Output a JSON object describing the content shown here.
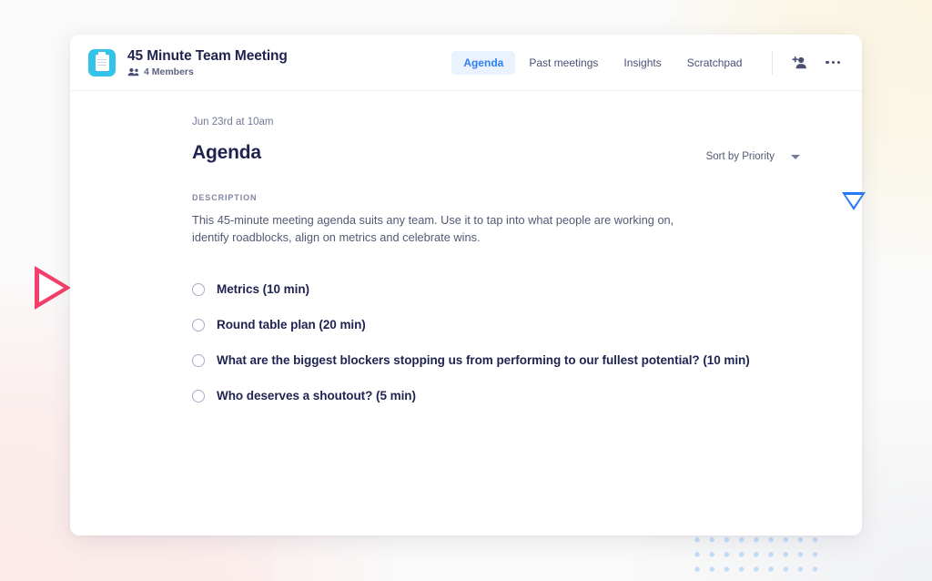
{
  "header": {
    "app_icon": "clipboard-icon",
    "meeting_title": "45 Minute Team Meeting",
    "members_icon": "people-icon",
    "members_text": "4 Members",
    "tabs": [
      {
        "label": "Agenda",
        "active": true
      },
      {
        "label": "Past meetings",
        "active": false
      },
      {
        "label": "Insights",
        "active": false
      },
      {
        "label": "Scratchpad",
        "active": false
      }
    ],
    "add_person_icon": "add-person-icon",
    "more_icon": "more-options-icon"
  },
  "main": {
    "date": "Jun 23rd at 10am",
    "page_title": "Agenda",
    "sort": {
      "label": "Sort by Priority",
      "chevron": "chevron-down-icon"
    },
    "description_label": "DESCRIPTION",
    "description_text": "This 45-minute meeting agenda suits any team. Use it to tap into what people are working on, identify roadblocks, align on metrics and celebrate wins.",
    "items": [
      {
        "label": "Metrics (10 min)",
        "checked": false
      },
      {
        "label": "Round table plan (20 min)",
        "checked": false
      },
      {
        "label": "What are the biggest blockers stopping us from performing to our fullest potential? (10 min)",
        "checked": false
      },
      {
        "label": "Who deserves a shoutout? (5 min)",
        "checked": false
      }
    ]
  },
  "decorations": {
    "triangle_left": "pink-triangle-right-pointing",
    "triangle_right": "blue-triangle-down-pointing",
    "semicircle": "green-semicircle",
    "dot_grid": "blue-dot-grid"
  },
  "colors": {
    "accent_blue": "#2f80f7",
    "tab_active_bg": "#eaf2fe",
    "app_icon_bg": "#34c3e8",
    "title_navy": "#1f2350",
    "body_text": "#545974",
    "pink_triangle": "#f43f6b",
    "blue_triangle": "#2979f5",
    "green_semicircle": "#a7ead0",
    "dot_blue": "#c5dcf7"
  }
}
